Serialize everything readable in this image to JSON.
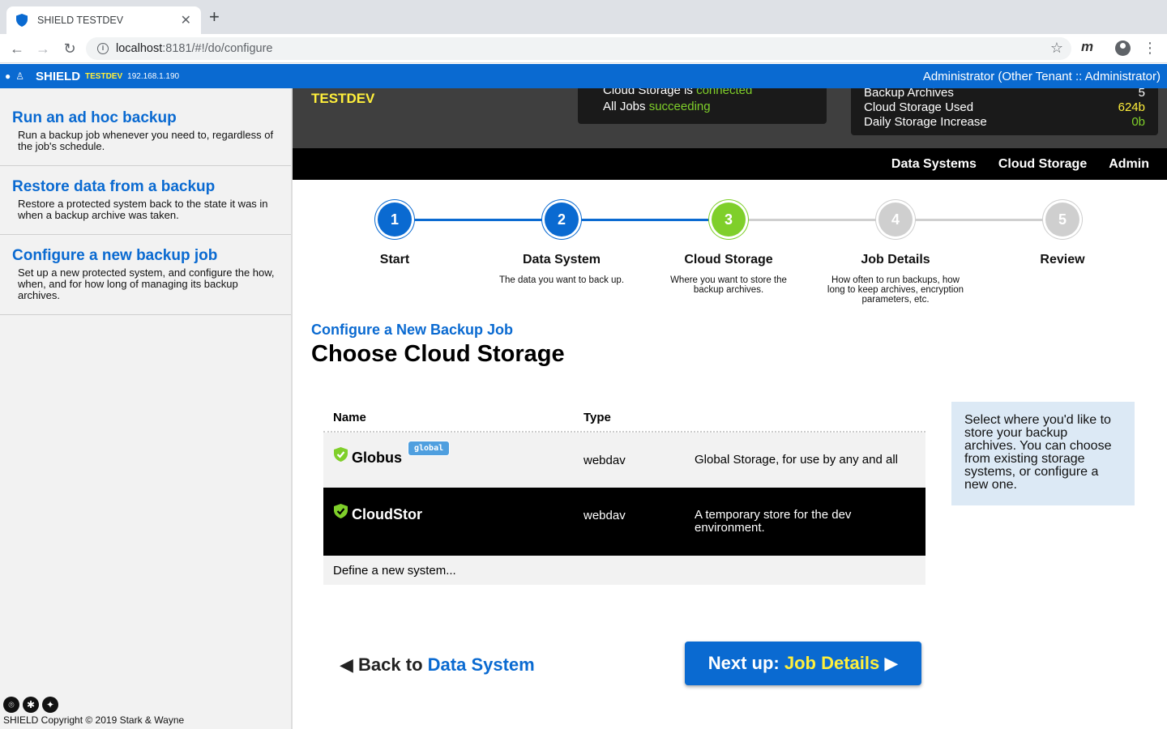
{
  "browser": {
    "tab_title": "SHIELD TESTDEV",
    "tab_close": "✕",
    "new_tab": "+",
    "url_host": "localhost",
    "url_path": ":8181/#!/do/configure"
  },
  "appbar": {
    "brand": "SHIELD",
    "env": "TESTDEV",
    "ip": "192.168.1.190",
    "user": "Administrator (Other Tenant :: Administrator)"
  },
  "sidebar": {
    "items": [
      {
        "title": "Run an ad hoc backup",
        "desc": "Run a backup job whenever you need to, regardless of the job's schedule."
      },
      {
        "title": "Restore data from a backup",
        "desc": "Restore a protected system back to the state it was in when a backup archive was taken."
      },
      {
        "title": "Configure a new backup job",
        "desc": "Set up a new protected system, and configure the how, when, and for how long of managing its backup archives."
      }
    ],
    "copyright": "SHIELD Copyright © 2019 Stark & Wayne"
  },
  "stats": {
    "tenant": "TESTDEV",
    "health": {
      "storage_prefix": "Cloud Storage is ",
      "storage_status": "connected",
      "jobs_prefix": "All Jobs ",
      "jobs_status": "succeeding"
    },
    "storage": [
      {
        "label": "Backup Archives",
        "value": "5",
        "color": "#ffffff"
      },
      {
        "label": "Cloud Storage Used",
        "value": "624b",
        "color": "#ffef3b"
      },
      {
        "label": "Daily Storage Increase",
        "value": "0b",
        "color": "#7fcf2a"
      }
    ]
  },
  "topnav": [
    "Data Systems",
    "Cloud Storage",
    "Admin"
  ],
  "wizard": {
    "steps": [
      {
        "num": "1",
        "label": "Start",
        "desc": "",
        "state": "done"
      },
      {
        "num": "2",
        "label": "Data System",
        "desc": "The data you want to back up.",
        "state": "done"
      },
      {
        "num": "3",
        "label": "Cloud Storage",
        "desc": "Where you want to store the backup archives.",
        "state": "active"
      },
      {
        "num": "4",
        "label": "Job Details",
        "desc": "How often to run backups, how long to keep archives, encryption parameters, etc.",
        "state": "todo"
      },
      {
        "num": "5",
        "label": "Review",
        "desc": "",
        "state": "todo"
      }
    ]
  },
  "page": {
    "breadcrumb": "Configure a New Backup Job",
    "title": "Choose Cloud Storage"
  },
  "table": {
    "headers": {
      "name": "Name",
      "type": "Type"
    },
    "rows": [
      {
        "name": "Globus",
        "badge": "global",
        "type": "webdav",
        "desc": "Global Storage, for use by any and all",
        "selected": false
      },
      {
        "name": "CloudStor",
        "badge": "",
        "type": "webdav",
        "desc": "A temporary store for the dev environment.",
        "selected": true
      }
    ],
    "new_row": "Define a new system..."
  },
  "hint": "Select where you'd like to store your backup archives. You can choose from existing storage systems, or configure a new one.",
  "footer_nav": {
    "back_prefix": "Back to ",
    "back_target": "Data System",
    "next_prefix": "Next up: ",
    "next_target": "Job Details"
  },
  "colors": {
    "brand_blue": "#0a6ad1",
    "accent_yellow": "#ffef3b",
    "success_green": "#7fcf2a"
  }
}
